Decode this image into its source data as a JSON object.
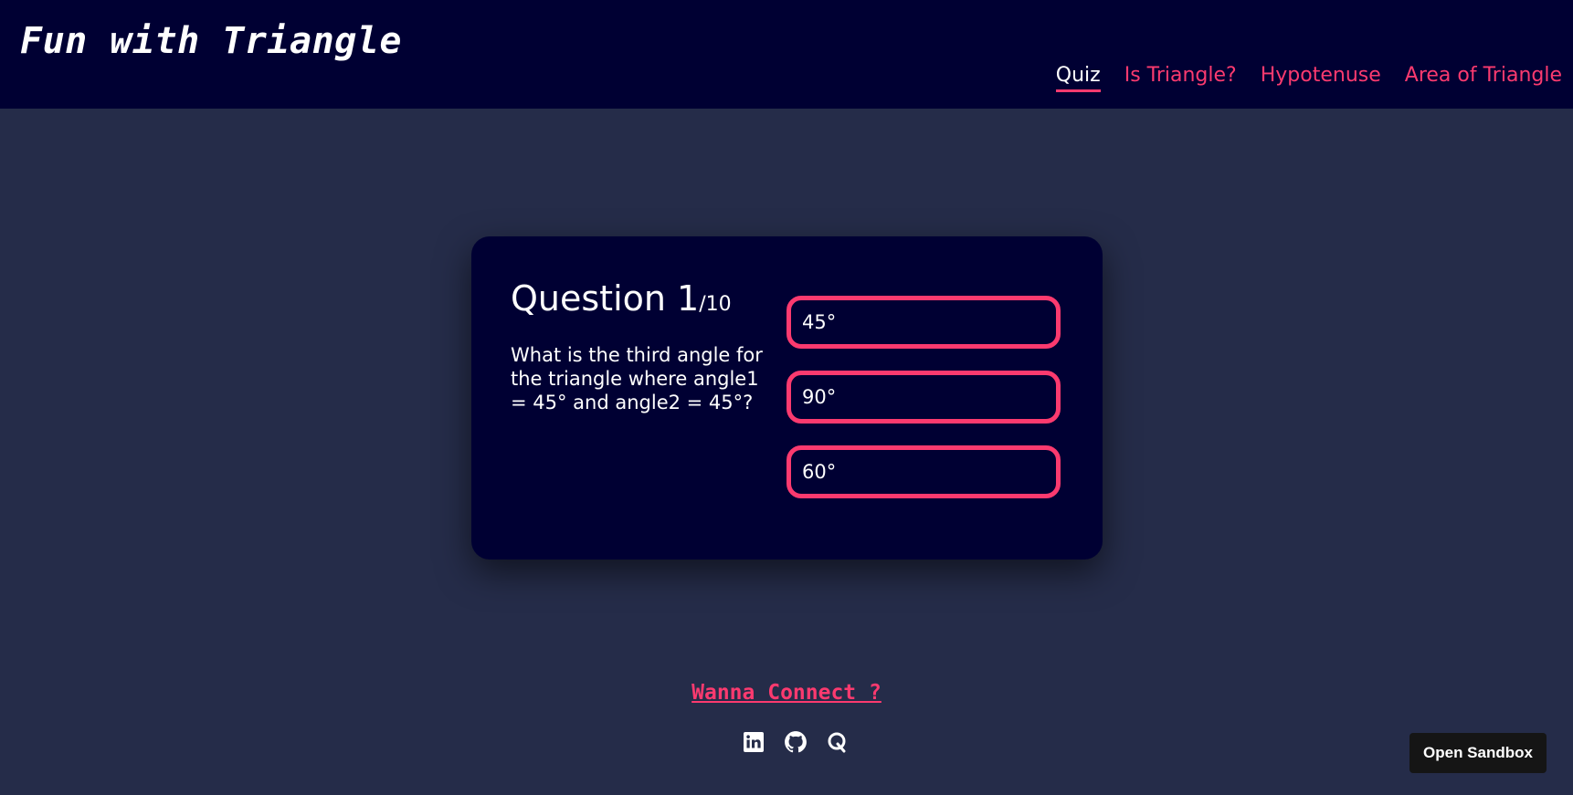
{
  "header": {
    "brand": "Fun with Triangle",
    "nav": [
      {
        "label": "Quiz",
        "active": true
      },
      {
        "label": "Is Triangle?",
        "active": false
      },
      {
        "label": "Hypotenuse",
        "active": false
      },
      {
        "label": "Area of Triangle",
        "active": false
      }
    ]
  },
  "quiz": {
    "question_label": "Question 1",
    "question_total": "/10",
    "question_text": "What is the third angle for the triangle where angle1 = 45° and angle2 = 45°?",
    "options": [
      "45°",
      "90°",
      "60°"
    ]
  },
  "footer": {
    "connect_label": "Wanna Connect ?",
    "social_icons": [
      "linkedin-icon",
      "github-icon",
      "quora-icon"
    ]
  },
  "sandbox": {
    "label": "Open Sandbox"
  },
  "colors": {
    "background": "#252c49",
    "header": "#000033",
    "accent": "#fb3a6f"
  }
}
